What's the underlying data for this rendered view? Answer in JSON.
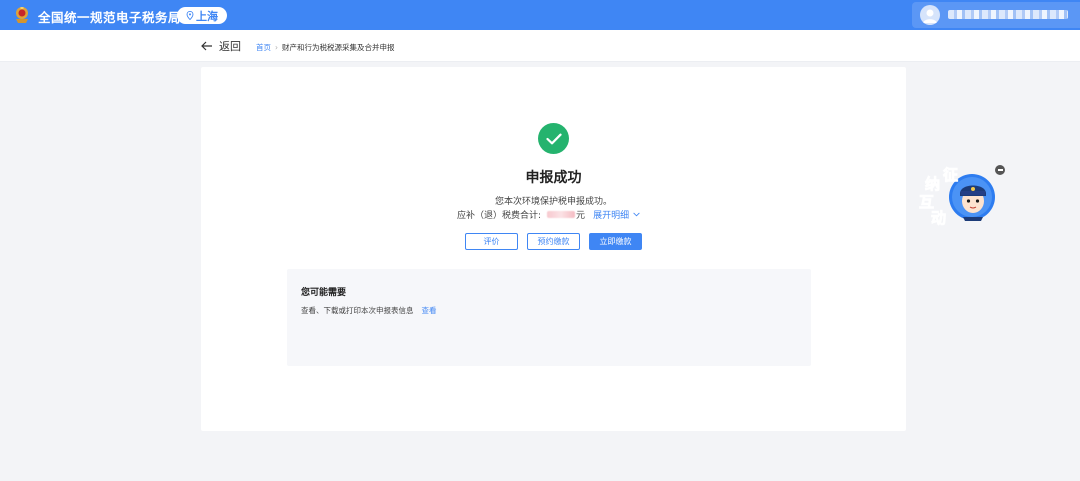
{
  "header": {
    "site_title": "全国统一规范电子税务局",
    "region": "上海",
    "user_name_blurred": true
  },
  "subheader": {
    "back_label": "返回",
    "breadcrumb": [
      "首页",
      "财产和行为税税源采集及合并申报"
    ]
  },
  "result": {
    "title": "申报成功",
    "description": "您本次环境保护税申报成功。",
    "amount_label": "应补（退）税费合计:",
    "amount_unit": "元",
    "expand_label": "展开明细"
  },
  "buttons": {
    "evaluate": "评价",
    "schedule_pay": "预约缴款",
    "pay_now": "立即缴款"
  },
  "suggest": {
    "title": "您可能需要",
    "item_text": "查看、下载或打印本次申报表信息",
    "item_link": "查看"
  },
  "float_widget": {
    "chars": [
      "征",
      "纳",
      "互",
      "动"
    ],
    "close_icon": "minus-circle-icon"
  },
  "colors": {
    "primary": "#3f86f4",
    "success": "#25b36e",
    "background": "#f3f4f7"
  }
}
